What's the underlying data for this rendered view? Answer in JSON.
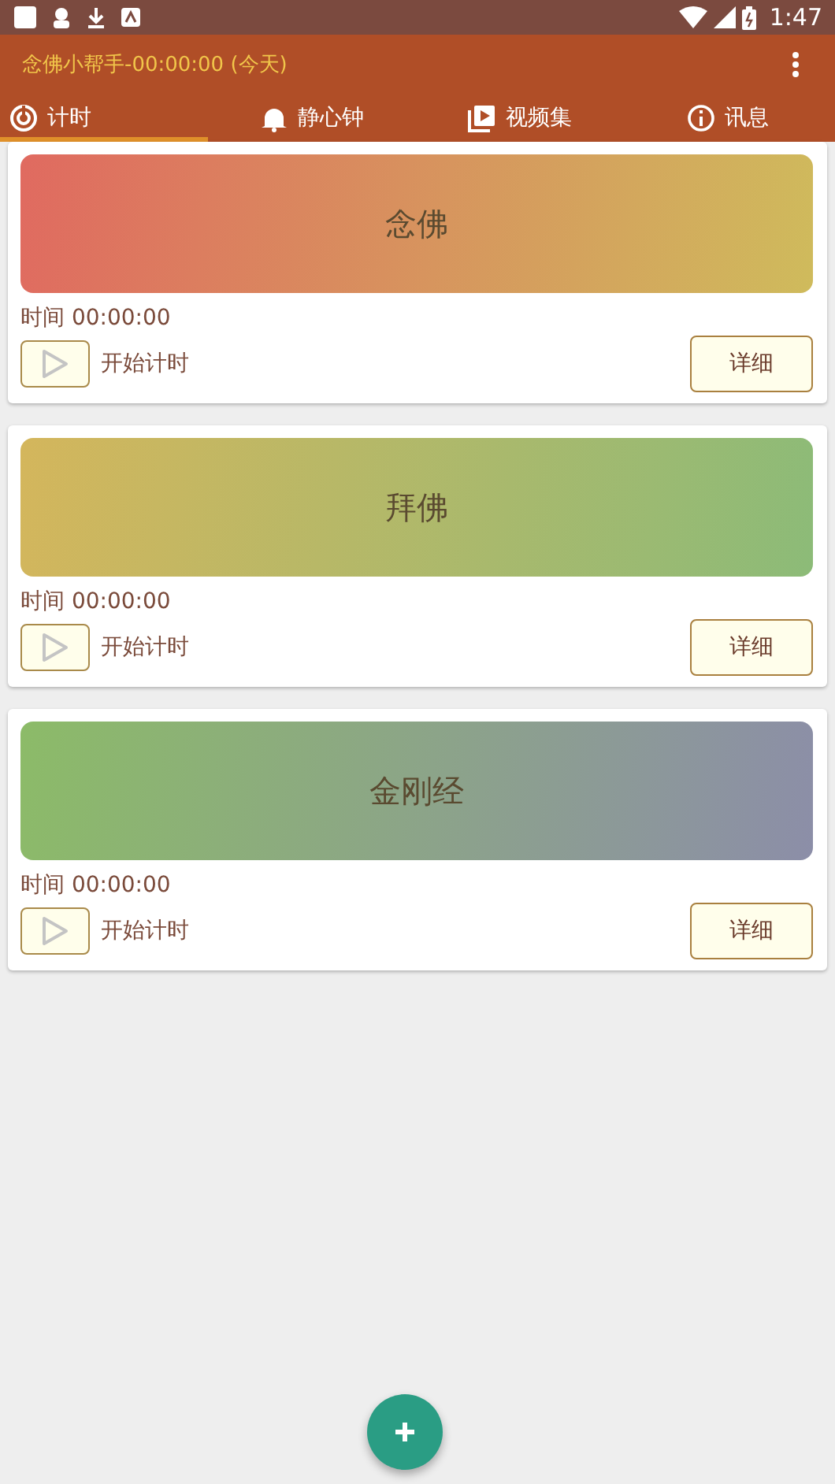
{
  "status_bar": {
    "time": "1:47"
  },
  "app_bar": {
    "title": "念佛小帮手-00:00:00 (今天)"
  },
  "tabs": [
    {
      "label": "计时",
      "kind": "timer",
      "selected": true
    },
    {
      "label": "静心钟",
      "kind": "bell",
      "selected": false
    },
    {
      "label": "视频集",
      "kind": "video",
      "selected": false
    },
    {
      "label": "讯息",
      "kind": "info",
      "selected": false
    }
  ],
  "cards": [
    {
      "title": "念佛",
      "color": "#e06a60",
      "gradient_end": {
        "color": "#cfbb5c"
      },
      "time": "时间 00:00:00",
      "start_label": "开始计时",
      "details_button": "详细"
    },
    {
      "title": "拜佛",
      "color": "#d4b65c",
      "gradient_end": {
        "color": "#8cbb78"
      },
      "time": "时间 00:00:00",
      "start_label": "开始计时",
      "details_button": "详细"
    },
    {
      "title": "金刚经",
      "color": "#8cbb68",
      "gradient_end": {
        "color": "#8c8ea8"
      },
      "time": "时间 00:00:00",
      "start_label": "开始计时",
      "details_button": "详细"
    }
  ]
}
